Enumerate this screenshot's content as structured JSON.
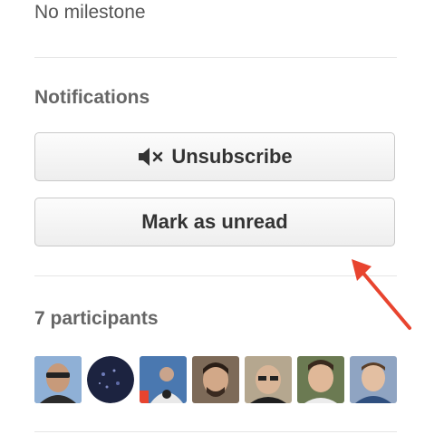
{
  "milestone": {
    "text": "No milestone"
  },
  "notifications": {
    "title": "Notifications",
    "unsubscribe_label": "Unsubscribe",
    "unsubscribe_icon": "mute-icon",
    "mark_unread_label": "Mark as unread"
  },
  "participants": {
    "title": "7 participants",
    "avatars": [
      {
        "name": "avatar-1",
        "bg": "#6c8fb8"
      },
      {
        "name": "avatar-2",
        "bg": "#1c2340"
      },
      {
        "name": "avatar-3",
        "bg": "#4a78b0"
      },
      {
        "name": "avatar-4",
        "bg": "#5b4a3e"
      },
      {
        "name": "avatar-5",
        "bg": "#3d3d3d"
      },
      {
        "name": "avatar-6",
        "bg": "#4d5a3b"
      },
      {
        "name": "avatar-7",
        "bg": "#6a7f9e"
      }
    ]
  },
  "colors": {
    "annotation_arrow": "#e8442f"
  }
}
